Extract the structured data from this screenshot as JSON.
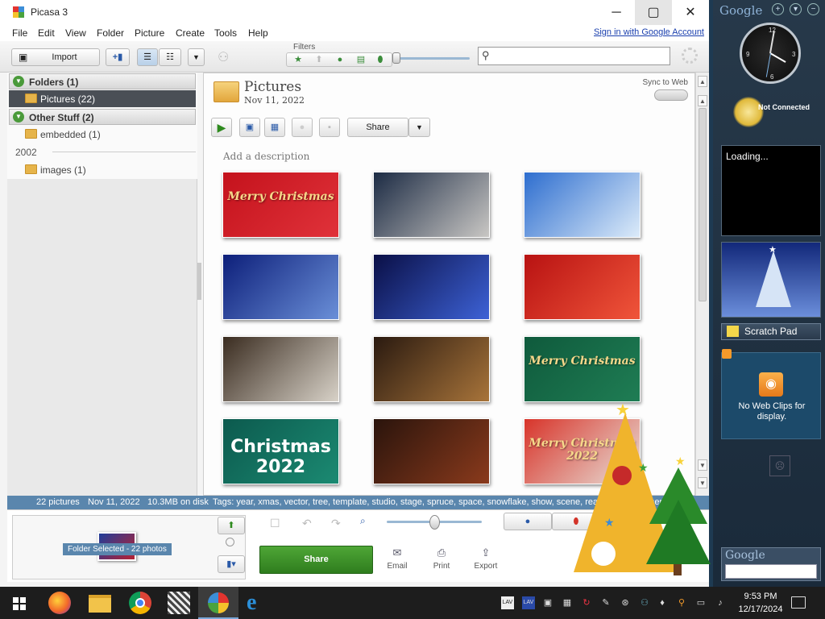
{
  "window": {
    "title": "Picasa 3",
    "menu": [
      "File",
      "Edit",
      "View",
      "Folder",
      "Picture",
      "Create",
      "Tools",
      "Help"
    ],
    "sign_in": "Sign in with Google Account"
  },
  "toolbar": {
    "import_label": "Import",
    "filters_label": "Filters",
    "search_placeholder": ""
  },
  "sidebar": {
    "groups": [
      {
        "label": "Folders (1)",
        "items": [
          {
            "label": "Pictures (22)",
            "selected": true
          }
        ]
      },
      {
        "label": "Other Stuff (2)",
        "items": [
          {
            "label": "embedded (1)"
          }
        ]
      }
    ],
    "year": "2002",
    "year_items": [
      {
        "label": "images (1)"
      }
    ]
  },
  "album": {
    "title": "Pictures",
    "date": "Nov 11, 2022",
    "sync_label": "Sync to Web",
    "share_label": "Share",
    "description_placeholder": "Add a description",
    "thumbnails": [
      {
        "caption": "Merry Christmas",
        "colors": [
          "#c4121c",
          "#e0323a"
        ]
      },
      {
        "caption": "",
        "colors": [
          "#1c2b44",
          "#c9c7c4"
        ]
      },
      {
        "caption": "",
        "colors": [
          "#2e6ecf",
          "#dcebf9"
        ]
      },
      {
        "caption": "",
        "colors": [
          "#0d1f7a",
          "#6a8fd8"
        ]
      },
      {
        "caption": "",
        "colors": [
          "#0a0f46",
          "#3d62d6"
        ]
      },
      {
        "caption": "",
        "colors": [
          "#b81212",
          "#f0553a"
        ]
      },
      {
        "caption": "",
        "colors": [
          "#3a2c20",
          "#d8d2c8"
        ]
      },
      {
        "caption": "",
        "colors": [
          "#2a1a10",
          "#a8743a"
        ]
      },
      {
        "caption": "Merry Christmas",
        "colors": [
          "#0f5a3c",
          "#1f7d54"
        ]
      },
      {
        "caption": "Christmas 2022",
        "colors": [
          "#0c5a4e",
          "#1b8a72"
        ]
      },
      {
        "caption": "",
        "colors": [
          "#2a140c",
          "#8a3a1c"
        ]
      },
      {
        "caption": "Merry Christmas 2022",
        "colors": [
          "#d8342a",
          "#e8e2da"
        ]
      }
    ]
  },
  "status": {
    "count": "22 pictures",
    "date": "Nov 11, 2022",
    "size": "10.3MB on disk",
    "tags": "Tags: year, xmas, vector, tree, template, studio, stage, spruce, space, snowflake, show, scene, realistic, pre... ...sents, ho..."
  },
  "tray": {
    "selected_badge": "Folder Selected - 22 photos",
    "share_label": "Share",
    "actions": [
      {
        "label": "Email",
        "icon": "envelope-icon"
      },
      {
        "label": "Print",
        "icon": "printer-icon"
      },
      {
        "label": "Export",
        "icon": "export-icon"
      }
    ]
  },
  "gadgets": {
    "logo": "Google",
    "weather_status": "Not Connected",
    "loading": "Loading...",
    "scratch_pad": "Scratch Pad",
    "webclips": "No Web Clips for display.",
    "search_logo": "Google"
  },
  "taskbar": {
    "time": "9:53 PM",
    "date": "12/17/2024"
  },
  "colors": {
    "accent_blue": "#5a86ad",
    "share_green": "#3e9a2c",
    "selected_folder": "#4a4f56"
  }
}
